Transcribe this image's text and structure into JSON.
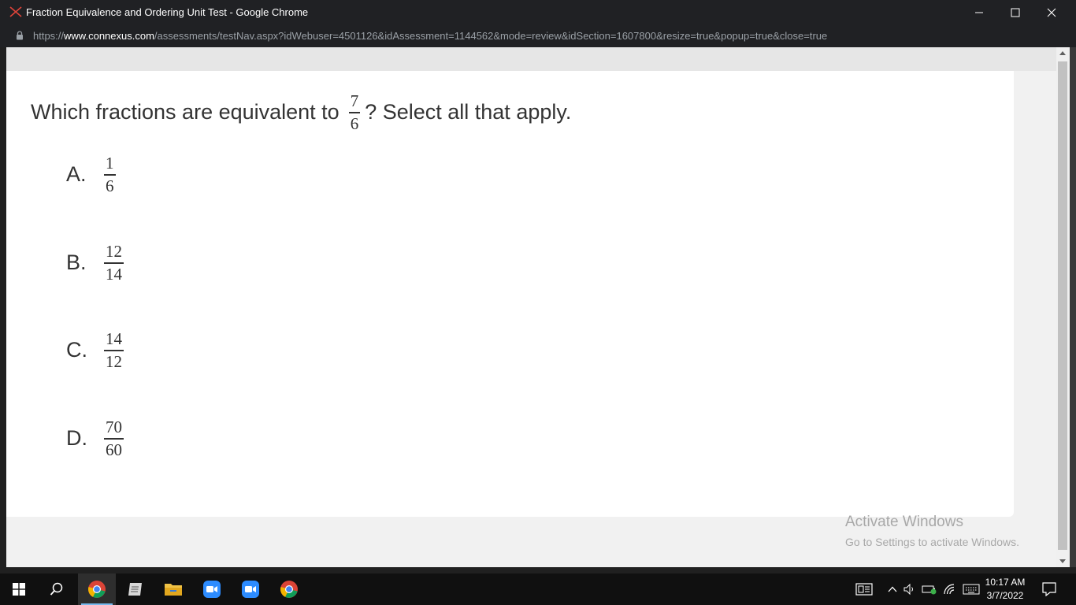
{
  "window": {
    "title": "Fraction Equivalence and Ordering Unit Test - Google Chrome",
    "app_icon": "connexus-logo-icon"
  },
  "address": {
    "url_prefix": "https://",
    "url_domain": "www.connexus.com",
    "url_path": "/assessments/testNav.aspx?idWebuser=4501126&idAssessment=1144562&mode=review&idSection=1607800&resize=true&popup=true&close=true"
  },
  "question": {
    "text_before": "Which fractions are equivalent to",
    "fraction": {
      "numerator": "7",
      "denominator": "6"
    },
    "text_after": "? Select all that apply."
  },
  "options": [
    {
      "letter": "A.",
      "numerator": "1",
      "denominator": "6"
    },
    {
      "letter": "B.",
      "numerator": "12",
      "denominator": "14"
    },
    {
      "letter": "C.",
      "numerator": "14",
      "denominator": "12"
    },
    {
      "letter": "D.",
      "numerator": "70",
      "denominator": "60"
    }
  ],
  "watermark": {
    "title": "Activate Windows",
    "subtitle": "Go to Settings to activate Windows."
  },
  "taskbar": {
    "time": "10:17 AM",
    "date": "3/7/2022",
    "pinned": [
      "chrome-icon",
      "notepad-icon",
      "file-explorer-icon",
      "zoom-icon",
      "zoom-icon",
      "chrome-icon"
    ]
  },
  "colors": {
    "titlebar": "#202124",
    "page_background": "#f1f1f1",
    "card": "#ffffff",
    "text": "#333333",
    "taskbar": "#101010",
    "accent": "#76b9ed"
  }
}
